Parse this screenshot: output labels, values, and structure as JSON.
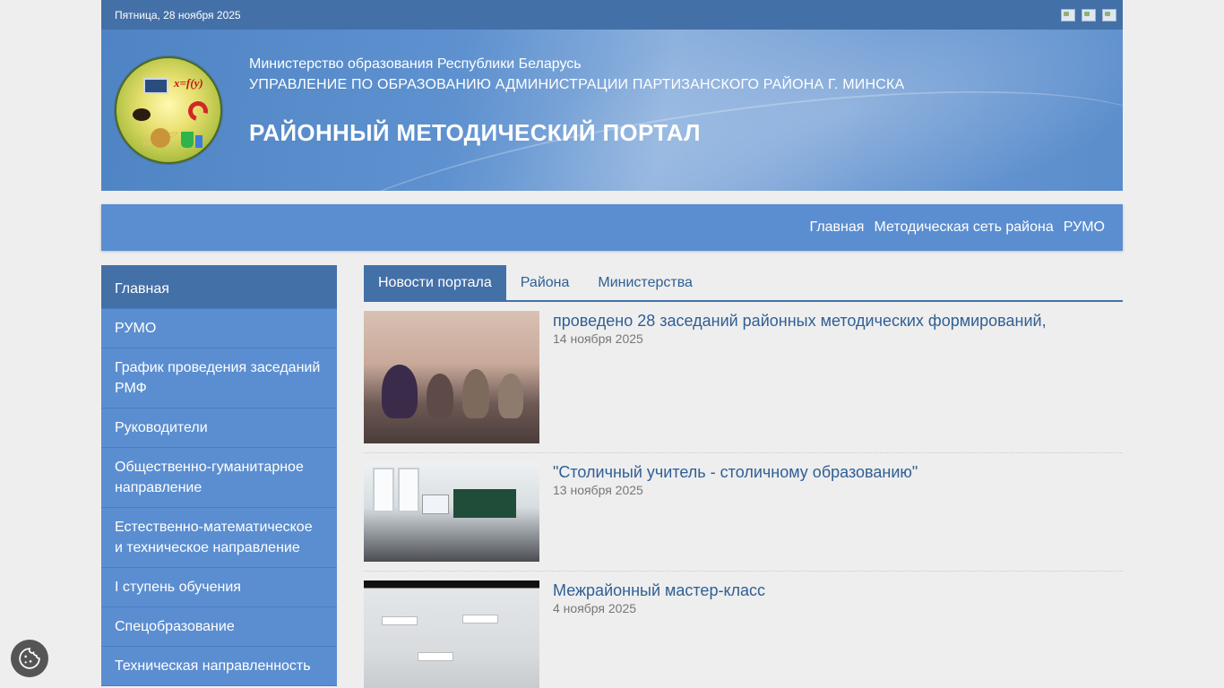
{
  "topbar": {
    "date": "Пятница, 28 ноября 2025"
  },
  "header": {
    "ministry": "Министерство образования Республики Беларусь",
    "admin": "УПРАВЛЕНИЕ ПО ОБРАЗОВАНИЮ АДМИНИСТРАЦИИ ПАРТИЗАНСКОГО РАЙОНА Г. МИНСКА",
    "portal": "РАЙОННЫЙ МЕТОДИЧЕСКИЙ ПОРТАЛ",
    "logo_formula": "x=f(y)"
  },
  "nav": [
    "Главная",
    "Методическая сеть района",
    "РУМО"
  ],
  "sidebar": [
    "Главная",
    "РУМО",
    "График проведения заседаний РМФ",
    "Руководители",
    "Общественно-гуманитарное направление",
    "Естественно-математическое и техническое направление",
    "I ступень обучения",
    "Спецобразование",
    "Техническая направленность"
  ],
  "tabs": [
    "Новости портала",
    "Района",
    "Министерства"
  ],
  "news": [
    {
      "title": "проведено 28 заседаний районных методических формирований,",
      "date": "14 ноября 2025"
    },
    {
      "title": "\"Столичный учитель - столичному образованию\"",
      "date": "13 ноября 2025"
    },
    {
      "title": "Межрайонный мастер-класс",
      "date": "4 ноября 2025"
    }
  ],
  "colors": {
    "primary": "#4470a8",
    "accent": "#5b8ed0",
    "link": "#2f5f95"
  }
}
